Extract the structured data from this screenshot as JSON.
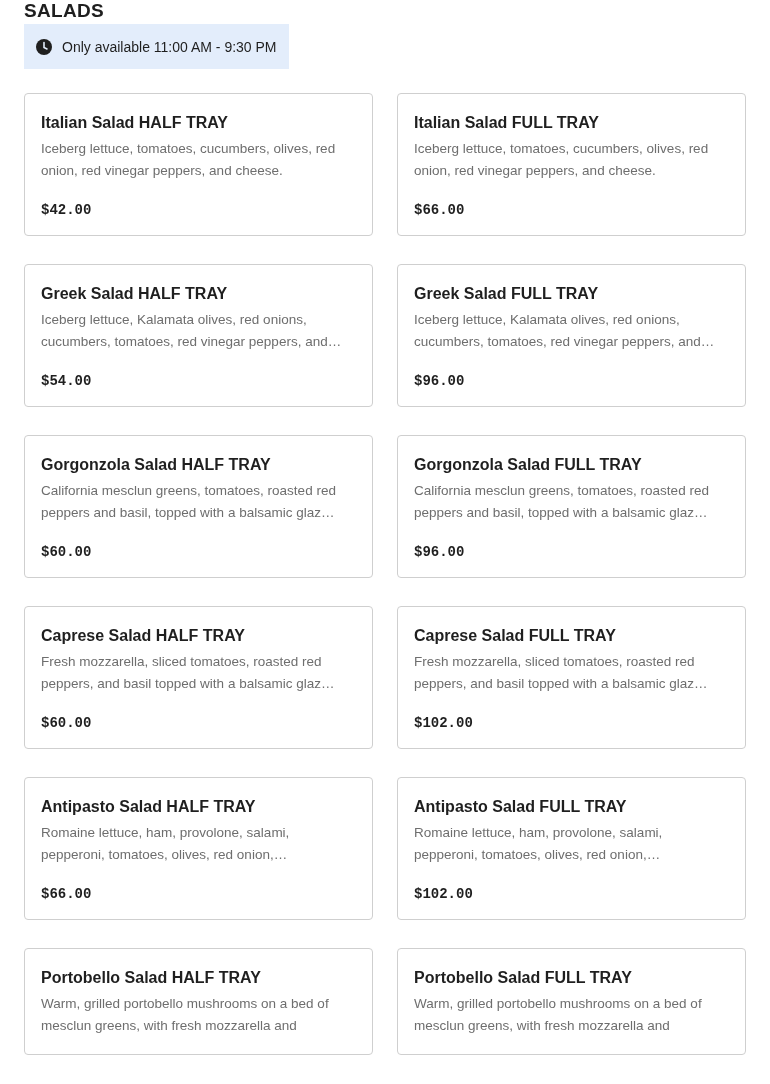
{
  "section": {
    "title": "SALADS",
    "availability": "Only available 11:00 AM - 9:30 PM"
  },
  "items": [
    {
      "name": "Italian Salad HALF TRAY",
      "description": "Iceberg lettuce, tomatoes, cucumbers, olives, red onion, red vinegar peppers, and cheese.",
      "price": "$42.00"
    },
    {
      "name": "Italian Salad FULL TRAY",
      "description": "Iceberg lettuce, tomatoes, cucumbers, olives, red onion, red vinegar peppers, and cheese.",
      "price": "$66.00"
    },
    {
      "name": "Greek Salad HALF TRAY",
      "description": "Iceberg lettuce, Kalamata olives, red onions, cucumbers, tomatoes, red vinegar peppers, and…",
      "price": "$54.00"
    },
    {
      "name": "Greek Salad FULL TRAY",
      "description": "Iceberg lettuce, Kalamata olives, red onions, cucumbers, tomatoes, red vinegar peppers, and…",
      "price": "$96.00"
    },
    {
      "name": "Gorgonzola Salad HALF TRAY",
      "description": "California mesclun greens, tomatoes, roasted red peppers and basil, topped with a balsamic glaz…",
      "price": "$60.00"
    },
    {
      "name": "Gorgonzola Salad FULL TRAY",
      "description": "California mesclun greens, tomatoes, roasted red peppers and basil, topped with a balsamic glaz…",
      "price": "$96.00"
    },
    {
      "name": "Caprese Salad HALF TRAY",
      "description": "Fresh mozzarella, sliced tomatoes, roasted red peppers, and basil topped with a balsamic glaz…",
      "price": "$60.00"
    },
    {
      "name": "Caprese Salad FULL TRAY",
      "description": "Fresh mozzarella, sliced tomatoes, roasted red peppers, and basil topped with a balsamic glaz…",
      "price": "$102.00"
    },
    {
      "name": "Antipasto Salad HALF TRAY",
      "description": "Romaine lettuce, ham, provolone, salami, pepperoni, tomatoes, olives, red onion,…",
      "price": "$66.00"
    },
    {
      "name": "Antipasto Salad FULL TRAY",
      "description": "Romaine lettuce, ham, provolone, salami, pepperoni, tomatoes, olives, red onion,…",
      "price": "$102.00"
    },
    {
      "name": "Portobello Salad HALF TRAY",
      "description": "Warm, grilled portobello mushrooms on a bed of mesclun greens, with fresh mozzarella and"
    },
    {
      "name": "Portobello Salad FULL TRAY",
      "description": "Warm, grilled portobello mushrooms on a bed of mesclun greens, with fresh mozzarella and"
    }
  ]
}
